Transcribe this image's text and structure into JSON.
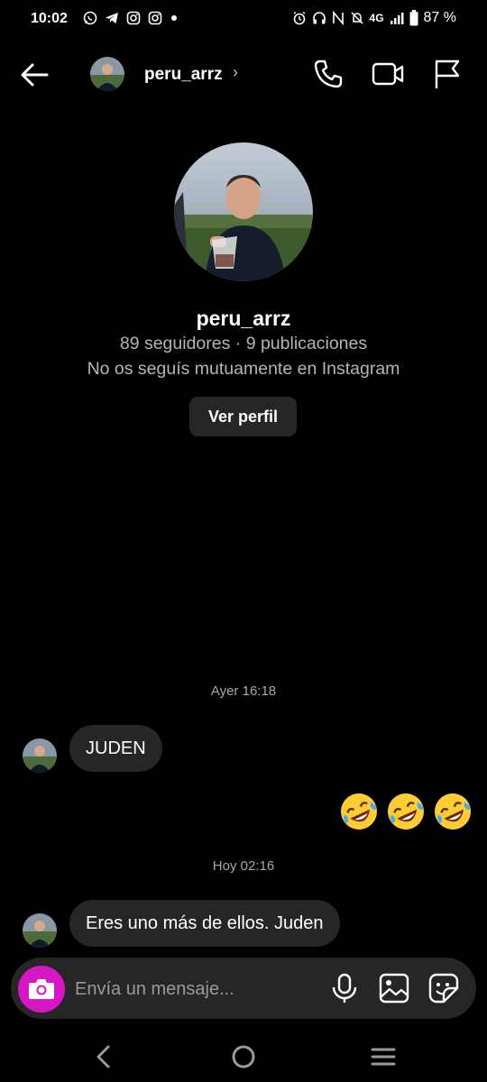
{
  "status_bar": {
    "time": "10:02",
    "network": "4G",
    "battery": "87 %",
    "left_icons": [
      "whatsapp-icon",
      "telegram-icon",
      "instagram-icon",
      "instagram-icon",
      "dot-icon"
    ],
    "right_icons": [
      "alarm-icon",
      "headphones-icon",
      "nfc-icon",
      "mute-icon",
      "signal-icon",
      "battery-icon"
    ]
  },
  "header": {
    "username": "peru_arrz",
    "chevron": "›",
    "icons": [
      "back-arrow-icon",
      "phone-icon",
      "video-icon",
      "flag-icon"
    ]
  },
  "profile": {
    "username": "peru_arrz",
    "stats": "89 seguidores · 9 publicaciones",
    "mutual": "No os seguís mutuamente en Instagram",
    "view_profile_label": "Ver perfil"
  },
  "messages": [
    {
      "timestamp": "Ayer 16:18"
    },
    {
      "sender": "peru_arrz",
      "text": "JUDEN"
    },
    {
      "sender": "me",
      "text": "🤣🤣🤣"
    },
    {
      "timestamp": "Hoy 02:16"
    },
    {
      "sender": "peru_arrz",
      "text": "Eres uno más de ellos. Juden"
    }
  ],
  "composer": {
    "placeholder": "Envía un mensaje...",
    "icons": [
      "camera-icon",
      "microphone-icon",
      "gallery-icon",
      "sticker-icon"
    ]
  },
  "nav_bar": {
    "icons": [
      "nav-back-icon",
      "home-icon",
      "recents-icon"
    ]
  },
  "colors": {
    "background": "#000000",
    "bubble": "#262626",
    "camera_button": "#d518c4",
    "secondary_text": "#b5b5b5"
  }
}
